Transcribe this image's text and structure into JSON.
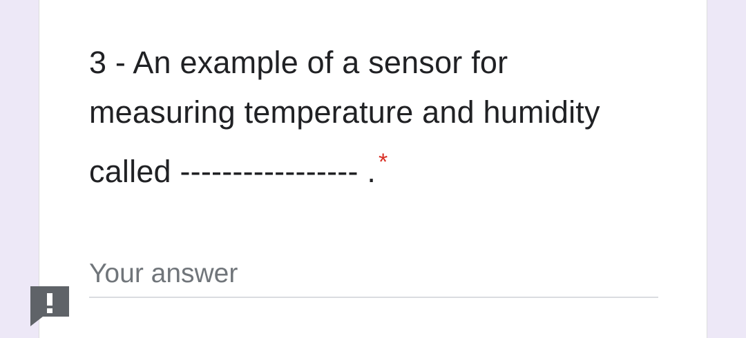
{
  "question": {
    "line1": "3 - An example of a sensor for",
    "line2": "measuring temperature and humidity",
    "line3": "called ----------------- .",
    "required_marker": "*"
  },
  "answer": {
    "placeholder": "Your answer",
    "value": ""
  },
  "icons": {
    "report": "report-problem-icon"
  },
  "colors": {
    "background": "#ede8f7",
    "card": "#ffffff",
    "text": "#202124",
    "required": "#d93025",
    "placeholder": "#70757a",
    "underline": "#dadce0",
    "report_icon": "#5f6368"
  }
}
